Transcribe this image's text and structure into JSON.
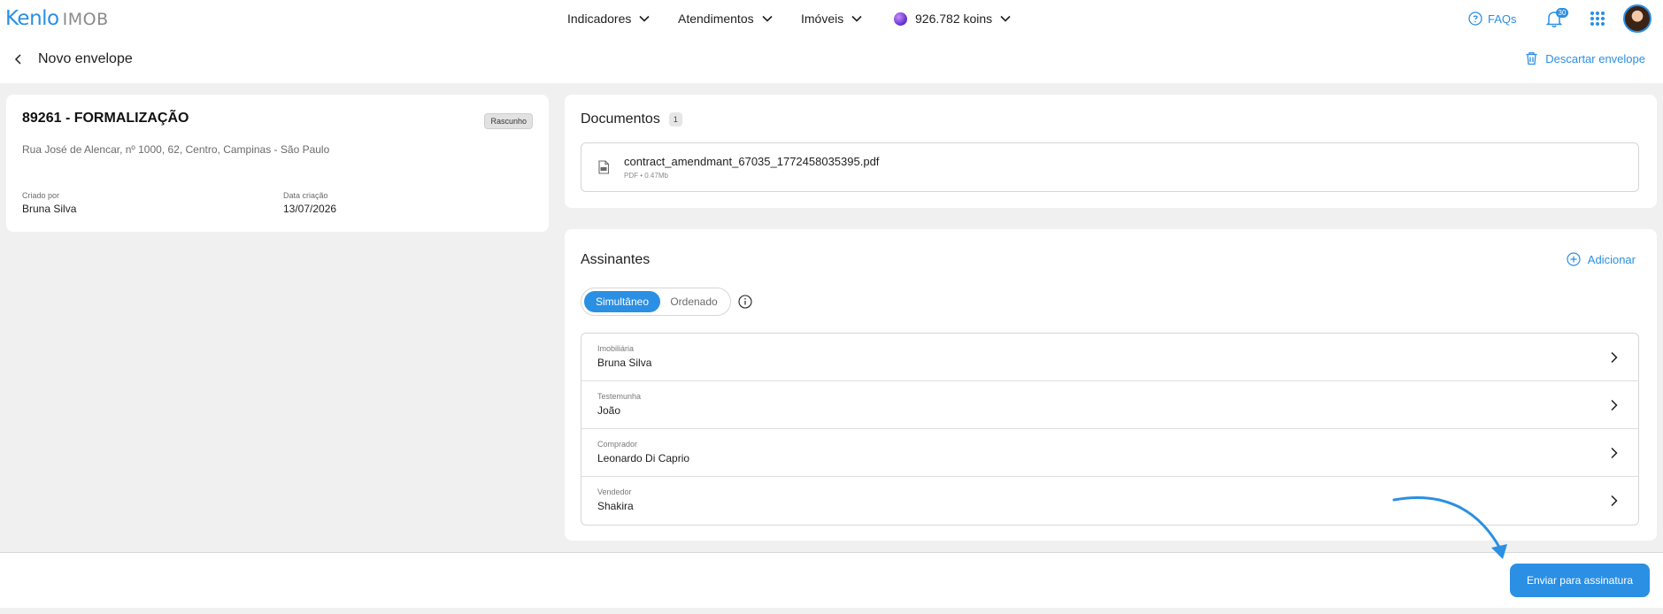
{
  "brand": {
    "logo_main": "Kenlo",
    "logo_sub": "IMOB"
  },
  "nav": {
    "items": [
      {
        "label": "Indicadores"
      },
      {
        "label": "Atendimentos"
      },
      {
        "label": "Imóveis"
      }
    ],
    "koins_label": "926.782 koins",
    "faq_label": "FAQs",
    "notifications_count": "30"
  },
  "page": {
    "title": "Novo envelope",
    "discard_label": "Descartar envelope"
  },
  "info_card": {
    "title": "89261 - FORMALIZAÇÃO",
    "status_badge": "Rascunho",
    "address": "Rua José de Alencar, nº 1000, 62, Centro, Campinas - São Paulo",
    "created_by_label": "Criado por",
    "created_by_value": "Bruna Silva",
    "created_date_label": "Data criação",
    "created_date_value": "13/07/2026"
  },
  "documents": {
    "title": "Documentos",
    "count": "1",
    "files": [
      {
        "name": "contract_amendmant_67035_1772458035395.pdf",
        "meta": "PDF • 0.47Mb"
      }
    ]
  },
  "signers": {
    "title": "Assinantes",
    "add_label": "Adicionar",
    "mode_options": [
      "Simultâneo",
      "Ordenado"
    ],
    "selected_mode": "Simultâneo",
    "rows": [
      {
        "role": "Imobiliária",
        "name": "Bruna Silva"
      },
      {
        "role": "Testemunha",
        "name": "João"
      },
      {
        "role": "Comprador",
        "name": "Leonardo Di Caprio"
      },
      {
        "role": "Vendedor",
        "name": "Shakira"
      }
    ]
  },
  "footer": {
    "send_label": "Enviar para assinatura"
  },
  "colors": {
    "accent": "#2b8fe3",
    "background": "#f0f0f0"
  }
}
